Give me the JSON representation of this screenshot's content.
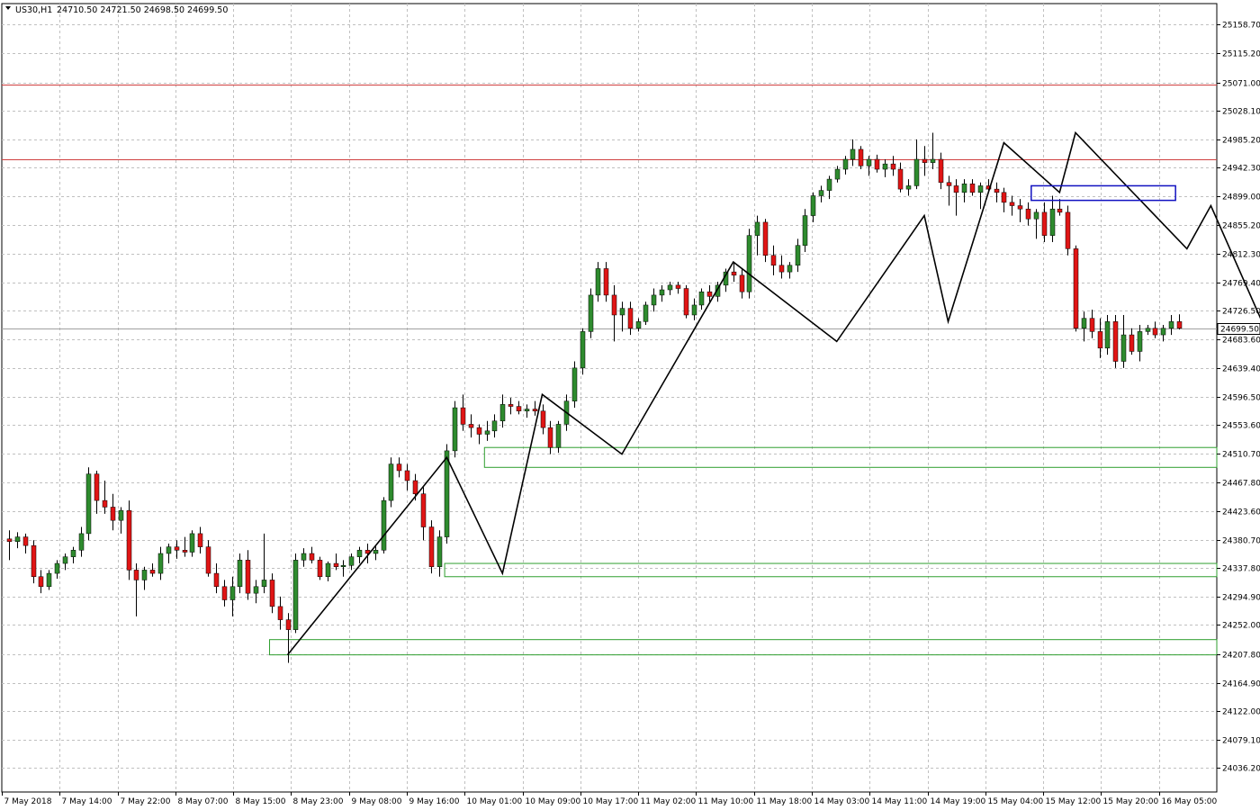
{
  "header": {
    "symbol": "US30,H1",
    "ohlc": "24710.50 24721.50 24698.50 24699.50"
  },
  "colors": {
    "bull": "#2e8b2e",
    "bear": "#e01515",
    "grid": "#c0c0c0",
    "resistance": "#d04040",
    "support": "#2e9e2e",
    "zigzag": "#000000",
    "range_box": "#1010c0",
    "price_line": "#a0a0a0"
  },
  "chart_data": {
    "type": "candlestick",
    "title": "US30,H1",
    "ylim": [
      24000,
      25190
    ],
    "y_ticks": [
      "25158.70",
      "25115.20",
      "25071.00",
      "25028.10",
      "24985.20",
      "24942.30",
      "24899.00",
      "24855.20",
      "24812.30",
      "24769.40",
      "24726.50",
      "24683.60",
      "24639.40",
      "24596.50",
      "24553.60",
      "24510.70",
      "24467.80",
      "24423.60",
      "24380.70",
      "24337.80",
      "24294.90",
      "24252.00",
      "24207.80",
      "24164.90",
      "24122.00",
      "24079.10",
      "24036.20"
    ],
    "x_labels": [
      "7 May 2018",
      "7 May 14:00",
      "7 May 22:00",
      "8 May 07:00",
      "8 May 15:00",
      "8 May 23:00",
      "9 May 08:00",
      "9 May 16:00",
      "10 May 01:00",
      "10 May 09:00",
      "10 May 17:00",
      "11 May 02:00",
      "11 May 10:00",
      "11 May 18:00",
      "14 May 03:00",
      "14 May 11:00",
      "14 May 19:00",
      "15 May 04:00",
      "15 May 12:00",
      "15 May 20:00",
      "16 May 05:00"
    ],
    "current_price": "24699.50",
    "candles": [
      [
        24382,
        24395,
        24350,
        24378
      ],
      [
        24378,
        24392,
        24368,
        24385
      ],
      [
        24385,
        24390,
        24360,
        24372
      ],
      [
        24372,
        24380,
        24315,
        24325
      ],
      [
        24325,
        24335,
        24300,
        24310
      ],
      [
        24310,
        24335,
        24305,
        24330
      ],
      [
        24330,
        24350,
        24322,
        24345
      ],
      [
        24345,
        24360,
        24335,
        24355
      ],
      [
        24355,
        24370,
        24345,
        24365
      ],
      [
        24365,
        24400,
        24355,
        24390
      ],
      [
        24390,
        24490,
        24380,
        24480
      ],
      [
        24480,
        24485,
        24420,
        24440
      ],
      [
        24440,
        24470,
        24420,
        24430
      ],
      [
        24430,
        24450,
        24395,
        24410
      ],
      [
        24410,
        24430,
        24390,
        24425
      ],
      [
        24425,
        24440,
        24320,
        24335
      ],
      [
        24335,
        24345,
        24265,
        24320
      ],
      [
        24320,
        24340,
        24305,
        24335
      ],
      [
        24335,
        24345,
        24325,
        24330
      ],
      [
        24330,
        24370,
        24320,
        24360
      ],
      [
        24360,
        24375,
        24345,
        24370
      ],
      [
        24370,
        24380,
        24352,
        24365
      ],
      [
        24365,
        24385,
        24355,
        24362
      ],
      [
        24362,
        24395,
        24355,
        24390
      ],
      [
        24390,
        24400,
        24360,
        24370
      ],
      [
        24370,
        24380,
        24325,
        24330
      ],
      [
        24330,
        24345,
        24300,
        24310
      ],
      [
        24310,
        24320,
        24280,
        24290
      ],
      [
        24290,
        24325,
        24265,
        24310
      ],
      [
        24310,
        24360,
        24300,
        24350
      ],
      [
        24350,
        24365,
        24290,
        24300
      ],
      [
        24300,
        24320,
        24285,
        24310
      ],
      [
        24310,
        24390,
        24300,
        24320
      ],
      [
        24320,
        24330,
        24270,
        24280
      ],
      [
        24280,
        24295,
        24245,
        24260
      ],
      [
        24260,
        24270,
        24195,
        24245
      ],
      [
        24245,
        24360,
        24240,
        24350
      ],
      [
        24350,
        24368,
        24340,
        24360
      ],
      [
        24360,
        24370,
        24345,
        24350
      ],
      [
        24350,
        24355,
        24320,
        24325
      ],
      [
        24325,
        24348,
        24318,
        24345
      ],
      [
        24345,
        24360,
        24335,
        24340
      ],
      [
        24340,
        24350,
        24325,
        24342
      ],
      [
        24342,
        24360,
        24335,
        24355
      ],
      [
        24355,
        24370,
        24345,
        24365
      ],
      [
        24365,
        24375,
        24345,
        24360
      ],
      [
        24360,
        24372,
        24350,
        24365
      ],
      [
        24365,
        24445,
        24360,
        24440
      ],
      [
        24440,
        24505,
        24430,
        24495
      ],
      [
        24495,
        24505,
        24475,
        24485
      ],
      [
        24485,
        24495,
        24455,
        24470
      ],
      [
        24470,
        24480,
        24440,
        24450
      ],
      [
        24450,
        24460,
        24380,
        24400
      ],
      [
        24400,
        24410,
        24330,
        24340
      ],
      [
        24340,
        24395,
        24325,
        24385
      ],
      [
        24385,
        24525,
        24375,
        24515
      ],
      [
        24515,
        24590,
        24505,
        24580
      ],
      [
        24580,
        24600,
        24545,
        24555
      ],
      [
        24555,
        24570,
        24535,
        24550
      ],
      [
        24550,
        24555,
        24525,
        24540
      ],
      [
        24540,
        24560,
        24530,
        24545
      ],
      [
        24545,
        24570,
        24535,
        24560
      ],
      [
        24560,
        24600,
        24550,
        24585
      ],
      [
        24585,
        24595,
        24570,
        24582
      ],
      [
        24582,
        24590,
        24570,
        24575
      ],
      [
        24575,
        24585,
        24565,
        24578
      ],
      [
        24578,
        24590,
        24568,
        24575
      ],
      [
        24575,
        24585,
        24540,
        24550
      ],
      [
        24550,
        24560,
        24510,
        24520
      ],
      [
        24520,
        24560,
        24512,
        24555
      ],
      [
        24555,
        24600,
        24545,
        24590
      ],
      [
        24590,
        24650,
        24580,
        24640
      ],
      [
        24640,
        24700,
        24630,
        24695
      ],
      [
        24695,
        24760,
        24685,
        24750
      ],
      [
        24750,
        24800,
        24740,
        24790
      ],
      [
        24790,
        24800,
        24740,
        24750
      ],
      [
        24750,
        24765,
        24680,
        24720
      ],
      [
        24720,
        24740,
        24695,
        24730
      ],
      [
        24730,
        24740,
        24690,
        24700
      ],
      [
        24700,
        24715,
        24695,
        24710
      ],
      [
        24710,
        24740,
        24705,
        24735
      ],
      [
        24735,
        24760,
        24725,
        24750
      ],
      [
        24750,
        24765,
        24740,
        24758
      ],
      [
        24758,
        24770,
        24750,
        24765
      ],
      [
        24765,
        24770,
        24752,
        24760
      ],
      [
        24760,
        24765,
        24715,
        24720
      ],
      [
        24720,
        24745,
        24712,
        24735
      ],
      [
        24735,
        24760,
        24728,
        24755
      ],
      [
        24755,
        24765,
        24740,
        24748
      ],
      [
        24748,
        24770,
        24740,
        24765
      ],
      [
        24765,
        24790,
        24755,
        24785
      ],
      [
        24785,
        24800,
        24770,
        24780
      ],
      [
        24780,
        24790,
        24745,
        24755
      ],
      [
        24755,
        24850,
        24745,
        24840
      ],
      [
        24840,
        24870,
        24810,
        24860
      ],
      [
        24860,
        24865,
        24800,
        24810
      ],
      [
        24810,
        24825,
        24780,
        24795
      ],
      [
        24795,
        24810,
        24775,
        24785
      ],
      [
        24785,
        24800,
        24775,
        24795
      ],
      [
        24795,
        24835,
        24785,
        24825
      ],
      [
        24825,
        24880,
        24815,
        24870
      ],
      [
        24870,
        24905,
        24860,
        24900
      ],
      [
        24900,
        24915,
        24890,
        24908
      ],
      [
        24908,
        24930,
        24895,
        24925
      ],
      [
        24925,
        24945,
        24920,
        24940
      ],
      [
        24940,
        24960,
        24932,
        24955
      ],
      [
        24955,
        24985,
        24945,
        24970
      ],
      [
        24970,
        24975,
        24940,
        24945
      ],
      [
        24945,
        24960,
        24930,
        24955
      ],
      [
        24955,
        24962,
        24935,
        24940
      ],
      [
        24940,
        24955,
        24928,
        24948
      ],
      [
        24948,
        24960,
        24930,
        24940
      ],
      [
        24940,
        24950,
        24905,
        24910
      ],
      [
        24910,
        24925,
        24900,
        24915
      ],
      [
        24915,
        24985,
        24910,
        24955
      ],
      [
        24955,
        24975,
        24930,
        24950
      ],
      [
        24950,
        24995,
        24940,
        24955
      ],
      [
        24955,
        24965,
        24910,
        24920
      ],
      [
        24920,
        24930,
        24885,
        24915
      ],
      [
        24915,
        24925,
        24870,
        24905
      ],
      [
        24905,
        24925,
        24890,
        24918
      ],
      [
        24918,
        24925,
        24900,
        24905
      ],
      [
        24905,
        24920,
        24880,
        24915
      ],
      [
        24915,
        24925,
        24905,
        24910
      ],
      [
        24910,
        24920,
        24890,
        24905
      ],
      [
        24905,
        24912,
        24875,
        24890
      ],
      [
        24890,
        24900,
        24870,
        24885
      ],
      [
        24885,
        24895,
        24860,
        24880
      ],
      [
        24880,
        24890,
        24855,
        24865
      ],
      [
        24865,
        24880,
        24835,
        24875
      ],
      [
        24875,
        24890,
        24830,
        24840
      ],
      [
        24840,
        24900,
        24830,
        24880
      ],
      [
        24880,
        24895,
        24870,
        24875
      ],
      [
        24875,
        24885,
        24810,
        24820
      ],
      [
        24820,
        24825,
        24695,
        24700
      ],
      [
        24700,
        24725,
        24680,
        24715
      ],
      [
        24715,
        24728,
        24685,
        24695
      ],
      [
        24695,
        24715,
        24655,
        24670
      ],
      [
        24670,
        24720,
        24660,
        24710
      ],
      [
        24710,
        24720,
        24640,
        24650
      ],
      [
        24650,
        24720,
        24640,
        24690
      ],
      [
        24690,
        24700,
        24660,
        24665
      ],
      [
        24665,
        24705,
        24650,
        24695
      ],
      [
        24695,
        24705,
        24690,
        24700
      ],
      [
        24700,
        24710,
        24685,
        24690
      ],
      [
        24690,
        24705,
        24680,
        24700
      ],
      [
        24700,
        24720,
        24690,
        24710
      ],
      [
        24710,
        24721,
        24698,
        24700
      ]
    ],
    "zigzag": [
      [
        35,
        24207
      ],
      [
        55,
        24505
      ],
      [
        62,
        24330
      ],
      [
        67,
        24600
      ],
      [
        77,
        24510
      ],
      [
        91,
        24800
      ],
      [
        104,
        24680
      ],
      [
        115,
        24870
      ],
      [
        118,
        24710
      ],
      [
        125,
        24980
      ],
      [
        132,
        24905
      ],
      [
        134,
        24995
      ],
      [
        148,
        24820
      ],
      [
        151,
        24885
      ],
      [
        160,
        24640
      ]
    ],
    "resistance_levels": [
      25068,
      24955
    ],
    "support_zones": [
      [
        24490,
        24520,
        62
      ],
      [
        24325,
        24345,
        57
      ],
      [
        24207,
        24230,
        35
      ]
    ],
    "range_box": {
      "start": 129,
      "end": 146,
      "low": 24893,
      "high": 24915
    }
  }
}
